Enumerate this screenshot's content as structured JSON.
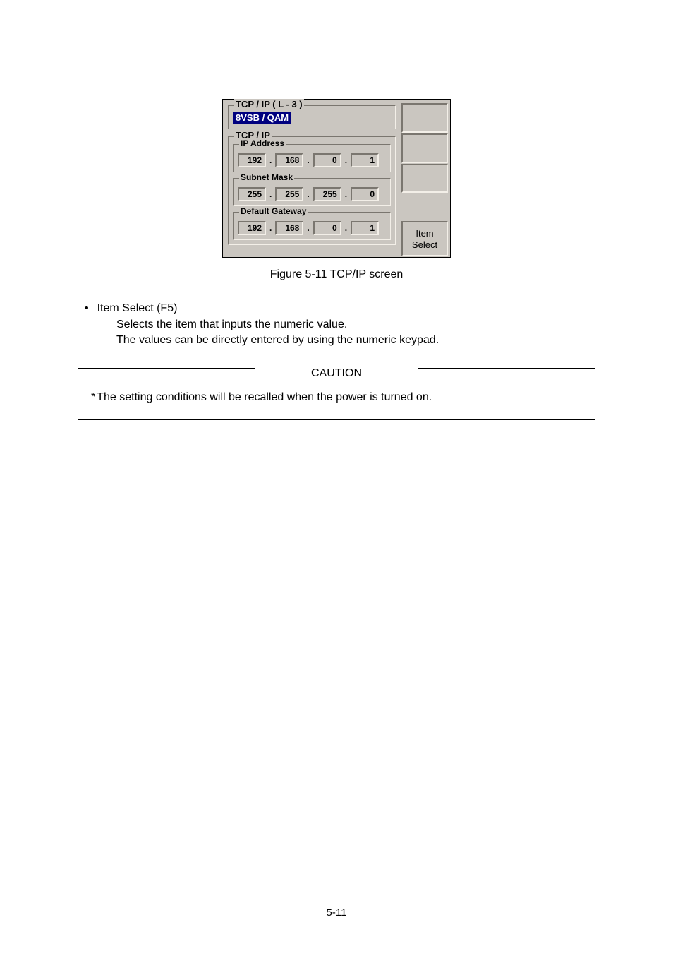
{
  "screen": {
    "outer_group": "TCP / IP ( L - 3 )",
    "selected_label": "8VSB / QAM",
    "tcpip_group": "TCP / IP",
    "ip_label": "IP Address",
    "ip": [
      "192",
      "168",
      "0",
      "1"
    ],
    "mask_label": "Subnet Mask",
    "mask": [
      "255",
      "255",
      "255",
      "0"
    ],
    "gw_label": "Default Gateway",
    "gw": [
      "192",
      "168",
      "0",
      "1"
    ],
    "item_select_line1": "Item",
    "item_select_line2": "Select"
  },
  "caption": "Figure 5-11    TCP/IP screen",
  "bullet": "•",
  "item_title": "Item Select (F5)",
  "body1": "Selects the item that inputs the numeric value.",
  "body2": "The values can be directly entered by using the numeric keypad.",
  "caution_label": "CAUTION",
  "ast": "*",
  "caution_text": "The setting conditions will be recalled when the power is turned on.",
  "pagenum": "5-11"
}
